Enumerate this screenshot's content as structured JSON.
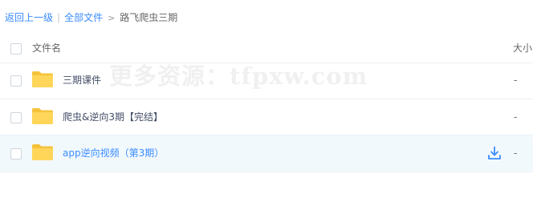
{
  "breadcrumb": {
    "back": "返回上一级",
    "all_files": "全部文件",
    "current": "路飞爬虫三期"
  },
  "header": {
    "name": "文件名",
    "size": "大小"
  },
  "files": [
    {
      "name": "三期课件",
      "size": "-",
      "icon": "folder-icon"
    },
    {
      "name": "爬虫&逆向3期【完结】",
      "size": "-",
      "icon": "folder-icon"
    },
    {
      "name": "app逆向视频（第3期）",
      "size": "-",
      "icon": "folder-icon",
      "action_icon": "download-icon"
    }
  ],
  "watermark": "更多资源：tfpxw.com",
  "colors": {
    "link": "#3b8cff",
    "folder": "#ffd659",
    "folder_dark": "#f5c33b",
    "row_highlight": "#f2f9fd"
  }
}
